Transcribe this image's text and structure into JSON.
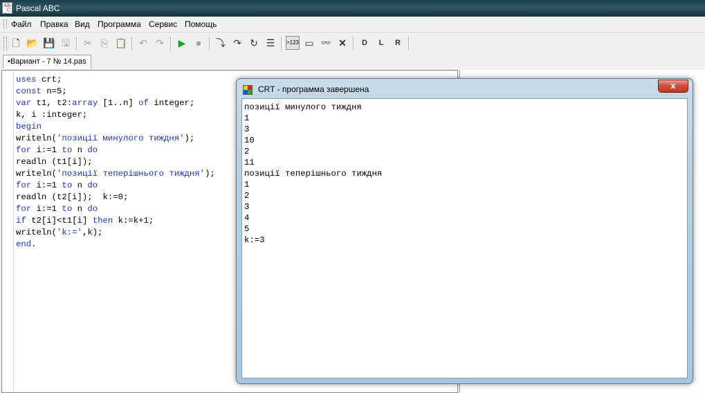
{
  "window": {
    "title": "Pascal ABC",
    "icon": "pascal-abc-app-icon",
    "icon_letters": [
      "AB",
      "C",
      "C"
    ]
  },
  "menu": {
    "items": [
      "Файл",
      "Правка",
      "Вид",
      "Программа",
      "Сервис",
      "Помощь"
    ]
  },
  "toolbar": {
    "buttons": [
      {
        "name": "new-file-icon",
        "glyph": "🗋"
      },
      {
        "name": "open-folder-icon",
        "glyph": "📂"
      },
      {
        "name": "save-icon",
        "glyph": "💾"
      },
      {
        "name": "save-all-icon",
        "glyph": "🖫"
      },
      {
        "name": "cut-icon",
        "glyph": "✂"
      },
      {
        "name": "copy-icon",
        "glyph": "⎘"
      },
      {
        "name": "paste-icon",
        "glyph": "📋"
      },
      {
        "name": "undo-icon",
        "glyph": "↶"
      },
      {
        "name": "redo-icon",
        "glyph": "↷"
      },
      {
        "name": "run-icon",
        "glyph": "▶"
      },
      {
        "name": "stop-icon",
        "glyph": "⏹"
      },
      {
        "name": "step-into-icon",
        "glyph": "⤵"
      },
      {
        "name": "step-over-icon",
        "glyph": "↷"
      },
      {
        "name": "run-to-cursor-icon",
        "glyph": "↻"
      },
      {
        "name": "debug-list-icon",
        "glyph": "☰"
      },
      {
        "name": "output-window-icon",
        "glyph": "▭"
      },
      {
        "name": "watch-icon",
        "glyph": "👓"
      },
      {
        "name": "close-icon",
        "glyph": "✕"
      },
      {
        "name": "doc-d-icon",
        "glyph": "D"
      },
      {
        "name": "doc-l-icon",
        "glyph": "L"
      },
      {
        "name": "doc-r-icon",
        "glyph": "R"
      }
    ],
    "pressed_label": ">123"
  },
  "tab": {
    "label": "•Вариант - 7 № 14.pas"
  },
  "code": [
    [
      {
        "t": "uses",
        "c": "kw"
      },
      {
        "t": " crt;"
      }
    ],
    [
      {
        "t": "const",
        "c": "kw"
      },
      {
        "t": " n=5;"
      }
    ],
    [
      {
        "t": "var",
        "c": "kw"
      },
      {
        "t": " t1, t2:"
      },
      {
        "t": "array",
        "c": "kw"
      },
      {
        "t": " [1..n] "
      },
      {
        "t": "of",
        "c": "kw"
      },
      {
        "t": " integer;"
      }
    ],
    [
      {
        "t": "k, i :integer;"
      }
    ],
    [
      {
        "t": "begin",
        "c": "kw"
      }
    ],
    [
      {
        "t": "writeln("
      },
      {
        "t": "'позиції минулого тиждня'",
        "c": "str"
      },
      {
        "t": ");"
      }
    ],
    [
      {
        "t": "for",
        "c": "kw"
      },
      {
        "t": " i:=1 "
      },
      {
        "t": "to",
        "c": "kw"
      },
      {
        "t": " n "
      },
      {
        "t": "do",
        "c": "kw"
      }
    ],
    [
      {
        "t": "readln (t1[i]);"
      }
    ],
    [
      {
        "t": "writeln("
      },
      {
        "t": "'позиції теперішнього тиждня'",
        "c": "str"
      },
      {
        "t": ");"
      }
    ],
    [
      {
        "t": "for",
        "c": "kw"
      },
      {
        "t": " i:=1 "
      },
      {
        "t": "to",
        "c": "kw"
      },
      {
        "t": " n "
      },
      {
        "t": "do",
        "c": "kw"
      }
    ],
    [
      {
        "t": "readln (t2[i]);  k:=0;"
      }
    ],
    [
      {
        "t": "for",
        "c": "kw"
      },
      {
        "t": " i:=1 "
      },
      {
        "t": "to",
        "c": "kw"
      },
      {
        "t": " n "
      },
      {
        "t": "do",
        "c": "kw"
      }
    ],
    [
      {
        "t": "if",
        "c": "kw"
      },
      {
        "t": " t2[i]<t1[i] "
      },
      {
        "t": "then",
        "c": "kw"
      },
      {
        "t": " k:=k+1;"
      }
    ],
    [
      {
        "t": "writeln("
      },
      {
        "t": "'k:='",
        "c": "str"
      },
      {
        "t": ",k);"
      }
    ],
    [
      {
        "t": "end",
        "c": "kw"
      },
      {
        "t": "."
      }
    ]
  ],
  "crt": {
    "title": "CRT - программа завершена",
    "close_label": "x",
    "output": [
      "позиції минулого тиждня",
      "1",
      "3",
      "10",
      "2",
      "11",
      "позиції теперішнього тиждня",
      "1",
      "2",
      "3",
      "4",
      "5",
      "k:=3"
    ]
  },
  "colors": {
    "keyword": "#1b33c7",
    "titlebar": "#2d5563",
    "crt_frame": "#b7d0e3",
    "close": "#c13722"
  }
}
